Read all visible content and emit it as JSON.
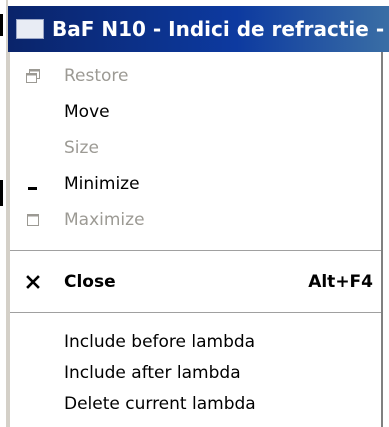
{
  "window": {
    "title": "BaF N10 - Indici de refractie -"
  },
  "menu": {
    "restore": {
      "label": "Restore",
      "icon": "restore-icon",
      "enabled": false
    },
    "move": {
      "label": "Move",
      "enabled": true
    },
    "size": {
      "label": "Size",
      "enabled": false
    },
    "minimize": {
      "label": "Minimize",
      "icon": "minimize-icon",
      "enabled": true
    },
    "maximize": {
      "label": "Maximize",
      "icon": "maximize-icon",
      "enabled": false
    },
    "close": {
      "label": "Close",
      "shortcut": "Alt+F4",
      "icon": "close-icon",
      "enabled": true
    },
    "include_before": {
      "label": "Include before lambda",
      "enabled": true
    },
    "include_after": {
      "label": "Include after lambda",
      "enabled": true
    },
    "delete_current": {
      "label": "Delete current lambda",
      "enabled": true
    }
  },
  "colors": {
    "titlebar_start": "#0a246a",
    "titlebar_end": "#3a6ea5",
    "disabled_text": "#9c9a94",
    "menu_background": "#ffffff"
  }
}
